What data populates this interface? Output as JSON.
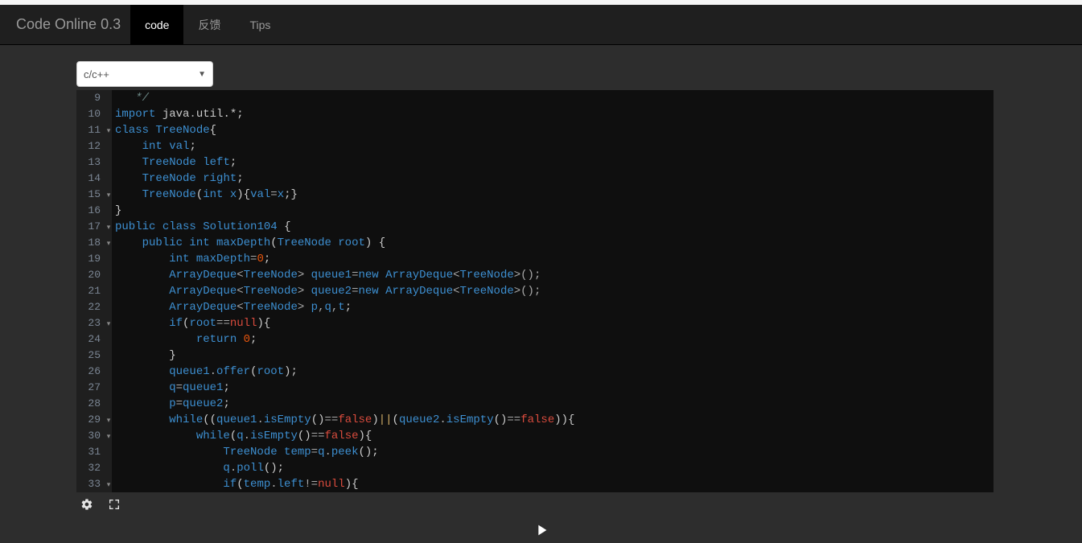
{
  "brand": "Code Online 0.3",
  "nav": {
    "tabs": [
      {
        "label": "code",
        "active": true
      },
      {
        "label": "反馈",
        "active": false
      },
      {
        "label": "Tips",
        "active": false
      }
    ]
  },
  "language_select": {
    "value": "c/c++"
  },
  "editor": {
    "first_line": 9,
    "fold_markers": [
      11,
      15,
      17,
      18,
      23,
      29,
      30,
      33
    ],
    "lines": [
      {
        "n": 9,
        "tokens": [
          [
            "   ",
            ""
          ],
          [
            "*/",
            "c-comment"
          ]
        ]
      },
      {
        "n": 10,
        "tokens": [
          [
            "import ",
            "c-keyword"
          ],
          [
            "java",
            "c-plain"
          ],
          [
            ".",
            "c-op"
          ],
          [
            "util",
            "c-plain"
          ],
          [
            ".*;",
            "c-plain"
          ]
        ]
      },
      {
        "n": 11,
        "tokens": [
          [
            "class ",
            "c-keyword"
          ],
          [
            "TreeNode",
            "c-classname"
          ],
          [
            "{",
            "c-paren"
          ]
        ]
      },
      {
        "n": 12,
        "tokens": [
          [
            "    ",
            ""
          ],
          [
            "int ",
            "c-type"
          ],
          [
            "val",
            "c-var"
          ],
          [
            ";",
            "c-semi"
          ]
        ]
      },
      {
        "n": 13,
        "tokens": [
          [
            "    ",
            ""
          ],
          [
            "TreeNode ",
            "c-type"
          ],
          [
            "left",
            "c-var"
          ],
          [
            ";",
            "c-semi"
          ]
        ]
      },
      {
        "n": 14,
        "tokens": [
          [
            "    ",
            ""
          ],
          [
            "TreeNode ",
            "c-type"
          ],
          [
            "right",
            "c-var"
          ],
          [
            ";",
            "c-semi"
          ]
        ]
      },
      {
        "n": 15,
        "tokens": [
          [
            "    ",
            ""
          ],
          [
            "TreeNode",
            "c-type"
          ],
          [
            "(",
            "c-paren"
          ],
          [
            "int ",
            "c-type"
          ],
          [
            "x",
            "c-var"
          ],
          [
            "){",
            "c-paren"
          ],
          [
            "val",
            "c-var"
          ],
          [
            "=",
            "c-op"
          ],
          [
            "x",
            "c-var"
          ],
          [
            ";}",
            "c-paren"
          ]
        ]
      },
      {
        "n": 16,
        "tokens": [
          [
            "}",
            "c-paren"
          ]
        ]
      },
      {
        "n": 17,
        "tokens": [
          [
            "public ",
            "c-keyword"
          ],
          [
            "class ",
            "c-keyword"
          ],
          [
            "Solution104 ",
            "c-classname"
          ],
          [
            "{",
            "c-paren"
          ]
        ]
      },
      {
        "n": 18,
        "tokens": [
          [
            "    ",
            ""
          ],
          [
            "public ",
            "c-keyword"
          ],
          [
            "int ",
            "c-type"
          ],
          [
            "maxDepth",
            "c-method"
          ],
          [
            "(",
            "c-paren"
          ],
          [
            "TreeNode ",
            "c-type"
          ],
          [
            "root",
            "c-var"
          ],
          [
            ") {",
            "c-paren"
          ]
        ]
      },
      {
        "n": 19,
        "tokens": [
          [
            "        ",
            ""
          ],
          [
            "int ",
            "c-type"
          ],
          [
            "maxDepth",
            "c-var"
          ],
          [
            "=",
            "c-op"
          ],
          [
            "0",
            "c-num"
          ],
          [
            ";",
            "c-semi"
          ]
        ]
      },
      {
        "n": 20,
        "tokens": [
          [
            "        ",
            ""
          ],
          [
            "ArrayDeque",
            "c-type"
          ],
          [
            "<",
            "c-op"
          ],
          [
            "TreeNode",
            "c-type"
          ],
          [
            "> ",
            "c-op"
          ],
          [
            "queue1",
            "c-var"
          ],
          [
            "=",
            "c-op"
          ],
          [
            "new ",
            "c-keyword"
          ],
          [
            "ArrayDeque",
            "c-type"
          ],
          [
            "<",
            "c-op"
          ],
          [
            "TreeNode",
            "c-type"
          ],
          [
            ">();",
            "c-op"
          ]
        ]
      },
      {
        "n": 21,
        "tokens": [
          [
            "        ",
            ""
          ],
          [
            "ArrayDeque",
            "c-type"
          ],
          [
            "<",
            "c-op"
          ],
          [
            "TreeNode",
            "c-type"
          ],
          [
            "> ",
            "c-op"
          ],
          [
            "queue2",
            "c-var"
          ],
          [
            "=",
            "c-op"
          ],
          [
            "new ",
            "c-keyword"
          ],
          [
            "ArrayDeque",
            "c-type"
          ],
          [
            "<",
            "c-op"
          ],
          [
            "TreeNode",
            "c-type"
          ],
          [
            ">();",
            "c-op"
          ]
        ]
      },
      {
        "n": 22,
        "tokens": [
          [
            "        ",
            ""
          ],
          [
            "ArrayDeque",
            "c-type"
          ],
          [
            "<",
            "c-op"
          ],
          [
            "TreeNode",
            "c-type"
          ],
          [
            "> ",
            "c-op"
          ],
          [
            "p",
            "c-var"
          ],
          [
            ",",
            "c-op"
          ],
          [
            "q",
            "c-var"
          ],
          [
            ",",
            "c-op"
          ],
          [
            "t",
            "c-var"
          ],
          [
            ";",
            "c-semi"
          ]
        ]
      },
      {
        "n": 23,
        "tokens": [
          [
            "        ",
            ""
          ],
          [
            "if",
            "c-keyword"
          ],
          [
            "(",
            "c-paren"
          ],
          [
            "root",
            "c-var"
          ],
          [
            "==",
            "c-op"
          ],
          [
            "null",
            "c-null"
          ],
          [
            "){",
            "c-paren"
          ]
        ]
      },
      {
        "n": 24,
        "tokens": [
          [
            "            ",
            ""
          ],
          [
            "return ",
            "c-keyword"
          ],
          [
            "0",
            "c-num"
          ],
          [
            ";",
            "c-semi"
          ]
        ]
      },
      {
        "n": 25,
        "tokens": [
          [
            "        ",
            ""
          ],
          [
            "}",
            "c-paren"
          ]
        ]
      },
      {
        "n": 26,
        "tokens": [
          [
            "        ",
            ""
          ],
          [
            "queue1",
            "c-var"
          ],
          [
            ".",
            "c-op"
          ],
          [
            "offer",
            "c-method"
          ],
          [
            "(",
            "c-paren"
          ],
          [
            "root",
            "c-var"
          ],
          [
            ");",
            "c-paren"
          ]
        ]
      },
      {
        "n": 27,
        "tokens": [
          [
            "        ",
            ""
          ],
          [
            "q",
            "c-var"
          ],
          [
            "=",
            "c-op"
          ],
          [
            "queue1",
            "c-var"
          ],
          [
            ";",
            "c-semi"
          ]
        ]
      },
      {
        "n": 28,
        "tokens": [
          [
            "        ",
            ""
          ],
          [
            "p",
            "c-var"
          ],
          [
            "=",
            "c-op"
          ],
          [
            "queue2",
            "c-var"
          ],
          [
            ";",
            "c-semi"
          ]
        ]
      },
      {
        "n": 29,
        "tokens": [
          [
            "        ",
            ""
          ],
          [
            "while",
            "c-keyword"
          ],
          [
            "((",
            "c-paren"
          ],
          [
            "queue1",
            "c-var"
          ],
          [
            ".",
            "c-op"
          ],
          [
            "isEmpty",
            "c-method"
          ],
          [
            "()",
            "c-paren"
          ],
          [
            "==",
            "c-op"
          ],
          [
            "false",
            "c-bool"
          ],
          [
            ")",
            "c-paren"
          ],
          [
            "||",
            "c-gold"
          ],
          [
            "(",
            "c-paren"
          ],
          [
            "queue2",
            "c-var"
          ],
          [
            ".",
            "c-op"
          ],
          [
            "isEmpty",
            "c-method"
          ],
          [
            "()",
            "c-paren"
          ],
          [
            "==",
            "c-op"
          ],
          [
            "false",
            "c-bool"
          ],
          [
            ")){",
            "c-paren"
          ]
        ]
      },
      {
        "n": 30,
        "tokens": [
          [
            "            ",
            ""
          ],
          [
            "while",
            "c-keyword"
          ],
          [
            "(",
            "c-paren"
          ],
          [
            "q",
            "c-var"
          ],
          [
            ".",
            "c-op"
          ],
          [
            "isEmpty",
            "c-method"
          ],
          [
            "()",
            "c-paren"
          ],
          [
            "==",
            "c-op"
          ],
          [
            "false",
            "c-bool"
          ],
          [
            "){",
            "c-paren"
          ]
        ]
      },
      {
        "n": 31,
        "tokens": [
          [
            "                ",
            ""
          ],
          [
            "TreeNode ",
            "c-type"
          ],
          [
            "temp",
            "c-var"
          ],
          [
            "=",
            "c-op"
          ],
          [
            "q",
            "c-var"
          ],
          [
            ".",
            "c-op"
          ],
          [
            "peek",
            "c-method"
          ],
          [
            "();",
            "c-paren"
          ]
        ]
      },
      {
        "n": 32,
        "tokens": [
          [
            "                ",
            ""
          ],
          [
            "q",
            "c-var"
          ],
          [
            ".",
            "c-op"
          ],
          [
            "poll",
            "c-method"
          ],
          [
            "();",
            "c-paren"
          ]
        ]
      },
      {
        "n": 33,
        "tokens": [
          [
            "                ",
            ""
          ],
          [
            "if",
            "c-keyword"
          ],
          [
            "(",
            "c-paren"
          ],
          [
            "temp",
            "c-var"
          ],
          [
            ".",
            "c-op"
          ],
          [
            "left",
            "c-var"
          ],
          [
            "!=",
            "c-op"
          ],
          [
            "null",
            "c-null"
          ],
          [
            "){",
            "c-paren"
          ]
        ]
      }
    ]
  }
}
